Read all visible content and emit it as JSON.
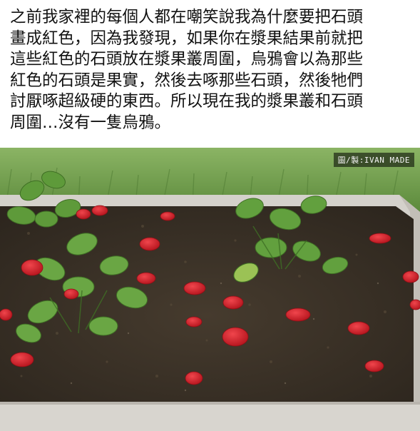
{
  "caption": {
    "lines": [
      "之前我家裡的每個人都在嘲笑說我為什麼要把石頭",
      "畫成紅色，因為我發現，如果你在漿果結果前就把",
      "這些紅色的石頭放在漿果叢周圍，烏鴉會以為那些",
      "紅色的石頭是果實，然後去啄那些石頭，然後牠們",
      "討厭啄超級硬的東西。所以現在我的漿果叢和石頭",
      "周圍…沒有一隻烏鴉。"
    ]
  },
  "photo": {
    "credit": "圖/製:IVAN MADE",
    "colors": {
      "grass": "#6f9a4a",
      "soil": "#3b3328",
      "frame": "#c9c6c1",
      "leaf": "#5e9a3a",
      "stone": "#d8232c"
    }
  }
}
